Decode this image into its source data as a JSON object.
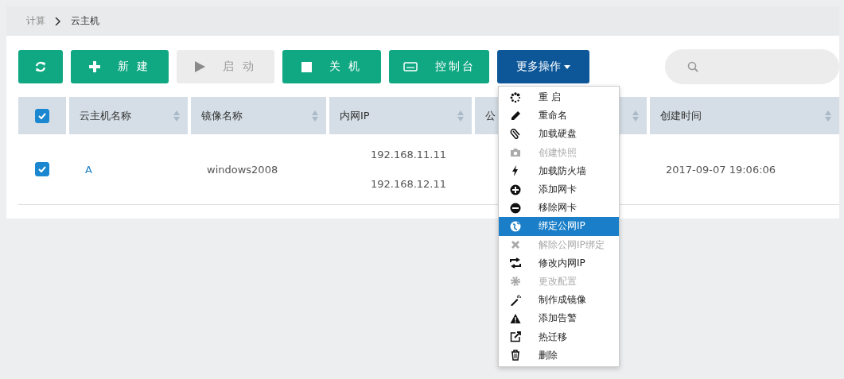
{
  "breadcrumb": [
    {
      "label": "计算"
    },
    {
      "label": "云主机"
    }
  ],
  "toolbar": {
    "buttons": [
      {
        "kind": "refresh",
        "disabled": false
      },
      {
        "kind": "new",
        "label": "新 建",
        "disabled": false
      },
      {
        "kind": "start",
        "label": "启 动",
        "disabled": true
      },
      {
        "kind": "stop",
        "label": "关 机",
        "disabled": false
      },
      {
        "kind": "console",
        "label": "控制台",
        "disabled": false
      }
    ],
    "more_button": {
      "label": "更多操作",
      "expanded": true
    }
  },
  "table": {
    "header_checked": true,
    "columns": [
      {
        "label": "云主机名称"
      },
      {
        "label": "镜像名称"
      },
      {
        "label": "内网IP"
      },
      {
        "label": "公"
      },
      {
        "label": "创建时间"
      }
    ],
    "rows": [
      {
        "checked": true,
        "name": "A",
        "image": "windows2008",
        "internal_ips": [
          "192.168.11.11",
          "192.168.12.11"
        ],
        "created": "2017-09-07 19:06:06"
      }
    ]
  },
  "menu": {
    "items": [
      {
        "label": "重 启",
        "disabled": false,
        "selected": false
      },
      {
        "label": "重命名",
        "disabled": false,
        "selected": false
      },
      {
        "label": "加载硬盘",
        "disabled": false,
        "selected": false
      },
      {
        "label": "创建快照",
        "disabled": true,
        "selected": false
      },
      {
        "label": "加载防火墙",
        "disabled": false,
        "selected": false
      },
      {
        "label": "添加网卡",
        "disabled": false,
        "selected": false
      },
      {
        "label": "移除网卡",
        "disabled": false,
        "selected": false
      },
      {
        "label": "绑定公网IP",
        "disabled": false,
        "selected": true
      },
      {
        "label": "解除公网IP绑定",
        "disabled": true,
        "selected": false
      },
      {
        "label": "修改内网IP",
        "disabled": false,
        "selected": false
      },
      {
        "label": "更改配置",
        "disabled": true,
        "selected": false
      },
      {
        "label": "制作成镜像",
        "disabled": false,
        "selected": false
      },
      {
        "label": "添加告警",
        "disabled": false,
        "selected": false
      },
      {
        "label": "热迁移",
        "disabled": false,
        "selected": false
      },
      {
        "label": "删除",
        "disabled": false,
        "selected": false
      }
    ]
  }
}
